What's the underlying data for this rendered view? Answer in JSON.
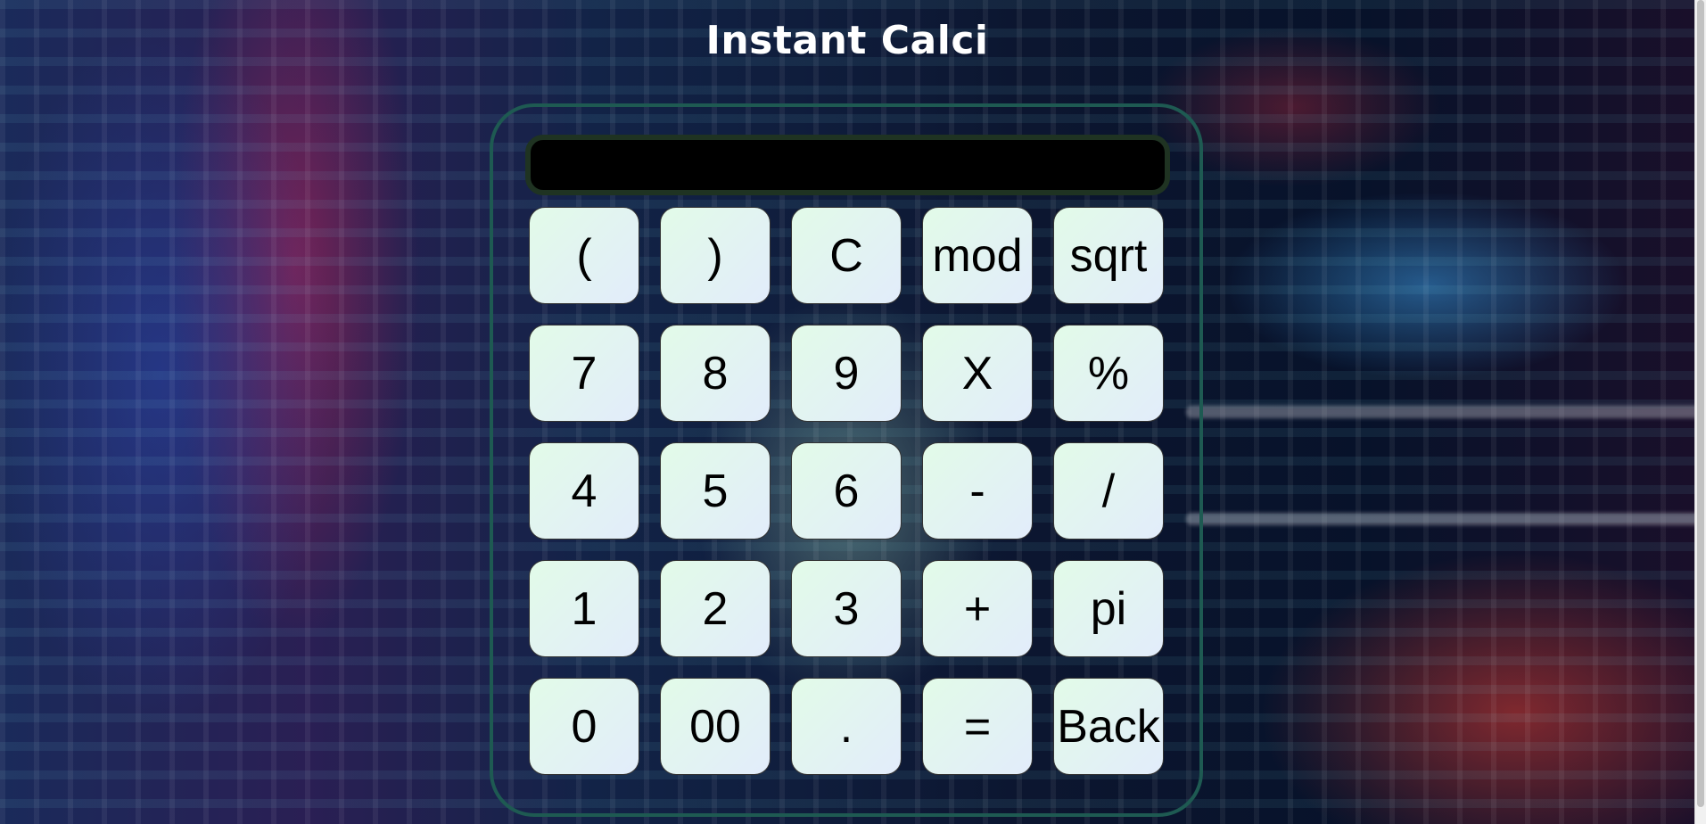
{
  "app": {
    "title": "Instant Calci"
  },
  "display": {
    "value": ""
  },
  "keys": [
    [
      "(",
      ")",
      "C",
      "mod",
      "sqrt"
    ],
    [
      "7",
      "8",
      "9",
      "X",
      "%"
    ],
    [
      "4",
      "5",
      "6",
      "-",
      "/"
    ],
    [
      "1",
      "2",
      "3",
      "+",
      "pi"
    ],
    [
      "0",
      "00",
      ".",
      "=",
      "Back"
    ]
  ],
  "colors": {
    "title": "#ffffff",
    "frame_border": "#1e5a52",
    "display_background": "#000000",
    "display_border": "#1f3322",
    "key_gradient_start": "#e2fbe8",
    "key_gradient_end": "#e2ecfb"
  }
}
